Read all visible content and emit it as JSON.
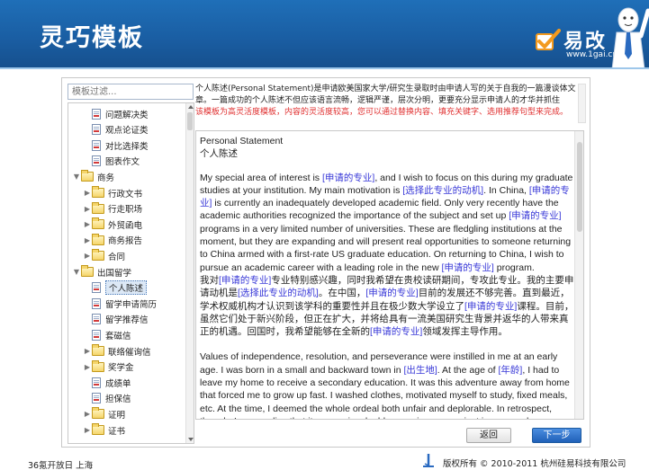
{
  "header": {
    "title": "灵巧模板",
    "logo_text": "易改",
    "logo_url": "www.1gai.cn"
  },
  "tree": {
    "filter_placeholder": "模板过滤...",
    "items": [
      {
        "label": "问题解决类",
        "type": "doc"
      },
      {
        "label": "观点论证类",
        "type": "doc"
      },
      {
        "label": "对比选择类",
        "type": "doc"
      },
      {
        "label": "图表作文",
        "type": "doc"
      },
      {
        "label": "商务",
        "type": "folder",
        "expanded": true
      },
      {
        "label": "行政文书",
        "type": "folder"
      },
      {
        "label": "行走职场",
        "type": "folder"
      },
      {
        "label": "外贸函电",
        "type": "folder"
      },
      {
        "label": "商务报告",
        "type": "folder"
      },
      {
        "label": "合同",
        "type": "folder"
      },
      {
        "label": "出国留学",
        "type": "folder",
        "expanded": true
      },
      {
        "label": "个人陈述",
        "type": "doc",
        "selected": true
      },
      {
        "label": "留学申请简历",
        "type": "doc"
      },
      {
        "label": "留学推荐信",
        "type": "doc"
      },
      {
        "label": "套磁信",
        "type": "doc"
      },
      {
        "label": "联络催询信",
        "type": "folder"
      },
      {
        "label": "奖学金",
        "type": "folder"
      },
      {
        "label": "成绩单",
        "type": "doc"
      },
      {
        "label": "担保信",
        "type": "doc"
      },
      {
        "label": "证明",
        "type": "folder"
      },
      {
        "label": "证书",
        "type": "folder"
      }
    ]
  },
  "description": {
    "text": "个人陈述(Personal Statement)是申请欧美国家大学/研究生录取时由申请人写的关于自我的一篇漫谈体文章。一篇成功的个人陈述不但应该语言流畅，逻辑严谨，层次分明，更要充分显示申请人的才华并抓住",
    "hint": "该模板为高灵活度模板，内容的灵活度较高，您可以通过替换内容、填充关键字、选用推荐句型来完成。"
  },
  "editor": {
    "heading_en": "Personal Statement",
    "heading_cn": "个人陈述",
    "p1": [
      {
        "t": "My special area of interest is "
      },
      {
        "t": "[申请的专业]",
        "ph": true
      },
      {
        "t": ", and I wish to focus on this during my graduate studies at your institution. My main motivation is "
      },
      {
        "t": "[选择此专业的动机]",
        "ph": true
      },
      {
        "t": ". In China, "
      },
      {
        "t": "[申请的专业]",
        "ph": true
      },
      {
        "t": " is currently an inadequately developed academic field. Only very recently have the academic authorities recognized the importance of the subject and set up "
      },
      {
        "t": "[申请的专业]",
        "ph": true
      },
      {
        "t": " programs in a very limited number of universities. These are fledgling institutions at the moment, but they are expanding and will present real opportunities to someone returning to China armed with a first-rate US graduate education. On returning to China, I wish to pursue an academic career with a leading role in the new "
      },
      {
        "t": "[申请的专业]",
        "ph": true
      },
      {
        "t": " program."
      }
    ],
    "p2": [
      {
        "t": "我对"
      },
      {
        "t": "[申请的专业]",
        "ph": true
      },
      {
        "t": "专业特别感兴趣，同时我希望在贵校读研期间，专攻此专业。我的主要申请动机是"
      },
      {
        "t": "[选择此专业的动机]",
        "ph": true
      },
      {
        "t": "。在中国，"
      },
      {
        "t": "[申请的专业]",
        "ph": true
      },
      {
        "t": "目前的发展还不够完善。直到最近，学术权威机构才认识到该学科的重要性并且在极少数大学设立了"
      },
      {
        "t": "[申请的专业]",
        "ph": true
      },
      {
        "t": "课程。目前，虽然它们处于新兴阶段，但正在扩大，并将给具有一流美国研究生背景并返华的人带来真正的机遇。回国时，我希望能够在全新的"
      },
      {
        "t": "[申请的专业]",
        "ph": true
      },
      {
        "t": "领域发挥主导作用。"
      }
    ],
    "p3": [
      {
        "t": "Values of independence, resolution, and perseverance were instilled in me at an early age. I was born in a small and backward town in "
      },
      {
        "t": "[出生地]",
        "ph": true
      },
      {
        "t": ". At the age of "
      },
      {
        "t": "[年龄]",
        "ph": true
      },
      {
        "t": ", I had to leave my home to receive a secondary education. It was this adventure away from home that forced me to grow up fast. I washed clothes, motivated myself to study, fixed meals, etc. At the time, I deemed the whole ordeal both unfair and deplorable. In retrospect, though, I now realize that it was an invaluable experience-a project in my own human capital-That"
      }
    ]
  },
  "buttons": {
    "back": "返回",
    "next": "下一步"
  },
  "footer": {
    "left": "36氪开放日 上海",
    "right": "版权所有 © 2010-2011 杭州硅易科技有限公司"
  },
  "colors": {
    "header": "#1a5ea3",
    "placeholder": "#3a3ad8",
    "hint_red": "#e03030",
    "next_button": "#2060b8"
  }
}
